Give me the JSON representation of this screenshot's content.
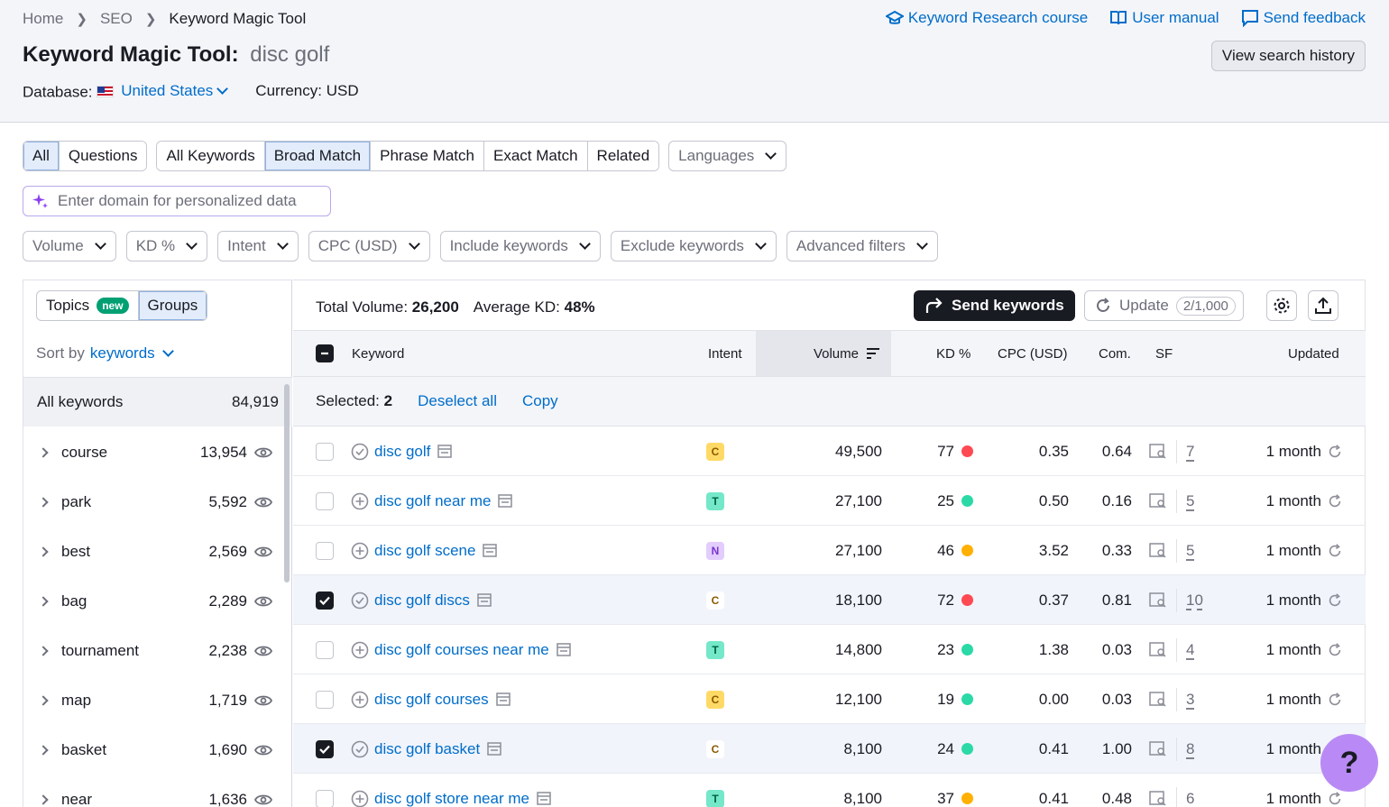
{
  "breadcrumb": [
    "Home",
    "SEO",
    "Keyword Magic Tool"
  ],
  "top_links": [
    {
      "label": "Keyword Research course",
      "icon": "graduation-cap-icon"
    },
    {
      "label": "User manual",
      "icon": "book-icon"
    },
    {
      "label": "Send feedback",
      "icon": "chat-icon"
    }
  ],
  "title": {
    "tool": "Keyword Magic Tool:",
    "query": "disc golf"
  },
  "history_button": "View search history",
  "database": {
    "label": "Database:",
    "value": "United States"
  },
  "currency": {
    "label": "Currency:",
    "value": "USD"
  },
  "tabs": {
    "scope": [
      "All",
      "Questions"
    ],
    "match": [
      "All Keywords",
      "Broad Match",
      "Phrase Match",
      "Exact Match",
      "Related"
    ],
    "languages": "Languages"
  },
  "domain_input": {
    "placeholder": "Enter domain for personalized data"
  },
  "filters": [
    "Volume",
    "KD %",
    "Intent",
    "CPC (USD)",
    "Include keywords",
    "Exclude keywords",
    "Advanced filters"
  ],
  "left_panel": {
    "topics": "Topics",
    "new_badge": "new",
    "groups": "Groups",
    "sort_label": "Sort by",
    "sort_value": "keywords",
    "all_label": "All keywords",
    "all_count": "84,919",
    "groups_list": [
      {
        "name": "course",
        "count": "13,954"
      },
      {
        "name": "park",
        "count": "5,592"
      },
      {
        "name": "best",
        "count": "2,569"
      },
      {
        "name": "bag",
        "count": "2,289"
      },
      {
        "name": "tournament",
        "count": "2,238"
      },
      {
        "name": "map",
        "count": "1,719"
      },
      {
        "name": "basket",
        "count": "1,690"
      },
      {
        "name": "near",
        "count": "1,636"
      }
    ]
  },
  "summary": {
    "total_label": "Total Volume:",
    "total": "26,200",
    "kd_label": "Average KD:",
    "kd": "48%"
  },
  "buttons": {
    "send": "Send keywords",
    "update": "Update",
    "update_count": "2/1,000"
  },
  "columns": {
    "keyword": "Keyword",
    "intent": "Intent",
    "volume": "Volume",
    "kd": "KD %",
    "cpc": "CPC (USD)",
    "com": "Com.",
    "sf": "SF",
    "updated": "Updated"
  },
  "selection": {
    "label": "Selected:",
    "count": "2",
    "deselect": "Deselect all",
    "copy": "Copy"
  },
  "colors": {
    "accent": "#006dca",
    "kd_high": "#ff4953",
    "kd_easy": "#2bd9a7",
    "kd_mid": "#ffb000",
    "help": "#b98af5"
  },
  "rows": [
    {
      "checked": false,
      "keyword": "disc golf",
      "added": true,
      "intent": "C",
      "volume": "49,500",
      "kd": "77",
      "kd_level": "high",
      "cpc": "0.35",
      "com": "0.64",
      "sf": "7",
      "updated": "1 month"
    },
    {
      "checked": false,
      "keyword": "disc golf near me",
      "added": false,
      "intent": "T",
      "volume": "27,100",
      "kd": "25",
      "kd_level": "easy",
      "cpc": "0.50",
      "com": "0.16",
      "sf": "5",
      "updated": "1 month"
    },
    {
      "checked": false,
      "keyword": "disc golf scene",
      "added": false,
      "intent": "N",
      "volume": "27,100",
      "kd": "46",
      "kd_level": "mid",
      "cpc": "3.52",
      "com": "0.33",
      "sf": "5",
      "updated": "1 month"
    },
    {
      "checked": true,
      "keyword": "disc golf discs",
      "added": true,
      "intent": "C",
      "volume": "18,100",
      "kd": "72",
      "kd_level": "high",
      "cpc": "0.37",
      "com": "0.81",
      "sf": "10",
      "updated": "1 month"
    },
    {
      "checked": false,
      "keyword": "disc golf courses near me",
      "added": false,
      "intent": "T",
      "volume": "14,800",
      "kd": "23",
      "kd_level": "easy",
      "cpc": "1.38",
      "com": "0.03",
      "sf": "4",
      "updated": "1 month"
    },
    {
      "checked": false,
      "keyword": "disc golf courses",
      "added": false,
      "intent": "C",
      "volume": "12,100",
      "kd": "19",
      "kd_level": "easy",
      "cpc": "0.00",
      "com": "0.03",
      "sf": "3",
      "updated": "1 month"
    },
    {
      "checked": true,
      "keyword": "disc golf basket",
      "added": true,
      "intent": "C",
      "volume": "8,100",
      "kd": "24",
      "kd_level": "easy",
      "cpc": "0.41",
      "com": "1.00",
      "sf": "8",
      "updated": "1 month"
    },
    {
      "checked": false,
      "keyword": "disc golf store near me",
      "added": false,
      "intent": "T",
      "volume": "8,100",
      "kd": "37",
      "kd_level": "mid",
      "cpc": "0.41",
      "com": "0.48",
      "sf": "6",
      "updated": "1 month"
    }
  ],
  "help": "?"
}
